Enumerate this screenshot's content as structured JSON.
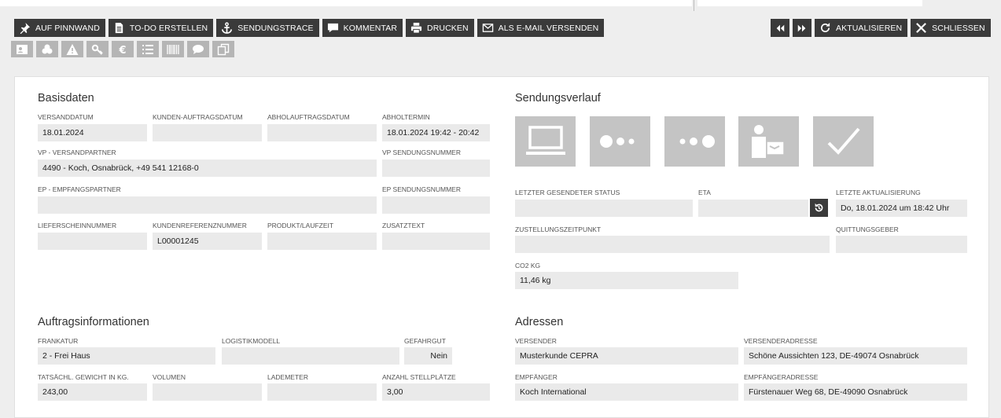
{
  "toolbar": {
    "pin_label": "AUF PINNWAND",
    "todo_label": "TO-DO ERSTELLEN",
    "trace_label": "SENDUNGSTRACE",
    "comment_label": "KOMMENTAR",
    "print_label": "DRUCKEN",
    "email_label": "ALS E-MAIL VERSENDEN",
    "refresh_label": "AKTUALISIEREN",
    "close_label": "SCHLIESSEN"
  },
  "basis": {
    "title": "Basisdaten",
    "versanddatum_label": "VERSANDDATUM",
    "versanddatum": "18.01.2024",
    "kundenauftragsdatum_label": "KUNDEN-AUFTRAGSDATUM",
    "kundenauftragsdatum": "",
    "abholauftragsdatum_label": "ABHOLAUFTRAGSDATUM",
    "abholauftragsdatum": "",
    "abholtermin_label": "ABHOLTERMIN",
    "abholtermin": "18.01.2024 19:42 - 20:42",
    "vp_label": "VP - VERSANDPARTNER",
    "vp": "4490 - Koch, Osnabrück, +49 541 12168-0",
    "vp_nr_label": "VP SENDUNGSNUMMER",
    "vp_nr": "",
    "ep_label": "EP - EMPFANGSPARTNER",
    "ep": "",
    "ep_nr_label": "EP SENDUNGSNUMMER",
    "ep_nr": "",
    "lieferschein_label": "LIEFERSCHEINNUMMER",
    "lieferschein": "",
    "kundenref_label": "KUNDENREFERENZNUMMER",
    "kundenref": "L00001245",
    "produkt_label": "PRODUKT/LAUFZEIT",
    "produkt": "",
    "zusatztext_label": "ZUSATZTEXT",
    "zusatztext": ""
  },
  "verlauf": {
    "title": "Sendungsverlauf",
    "icons": [
      "computer-icon",
      "dots-progress-icon",
      "dots-progress-icon",
      "person-package-icon",
      "checkmark-icon"
    ],
    "status_label": "LETZTER GESENDETER STATUS",
    "status": "",
    "eta_label": "ETA",
    "eta": "",
    "update_label": "LETZTE AKTUALISIERUNG",
    "update": "Do, 18.01.2024 um 18:42 Uhr",
    "zustellung_label": "ZUSTELLUNGSZEITPUNKT",
    "zustellung": "",
    "quittung_label": "QUITTUNGSGEBER",
    "quittung": "",
    "co2_label": "CO2 KG",
    "co2": "11,46 kg"
  },
  "auftrag": {
    "title": "Auftragsinformationen",
    "frankatur_label": "FRANKATUR",
    "frankatur": "2 - Frei Haus",
    "logistik_label": "LOGISTIKMODELL",
    "logistik": "",
    "gefahrgut_label": "GEFAHRGUT",
    "gefahrgut": "Nein",
    "gewicht_label": "TATSÄCHL. GEWICHT IN KG.",
    "gewicht": "243,00",
    "volumen_label": "VOLUMEN",
    "volumen": "",
    "lademeter_label": "LADEMETER",
    "lademeter": "",
    "stellplaetze_label": "ANZAHL STELLPLÄTZE",
    "stellplaetze": "3,00"
  },
  "adressen": {
    "title": "Adressen",
    "versender_label": "VERSENDER",
    "versender": "Musterkunde CEPRA",
    "versenderadresse_label": "VERSENDERADRESSE",
    "versenderadresse": "Schöne Aussichten 123, DE-49074 Osnabrück",
    "empfaenger_label": "EMPFÄNGER",
    "empfaenger": "Koch International",
    "empfaengeradresse_label": "EMPFÄNGERADRESSE",
    "empfaengeradresse": "Fürstenauer Weg 68, DE-49090 Osnabrück"
  },
  "colors": {
    "button_dark": "#3a3a3a",
    "button_grey": "#b5b5b5",
    "tile": "#c4c4c4",
    "field": "#eaeaea"
  }
}
